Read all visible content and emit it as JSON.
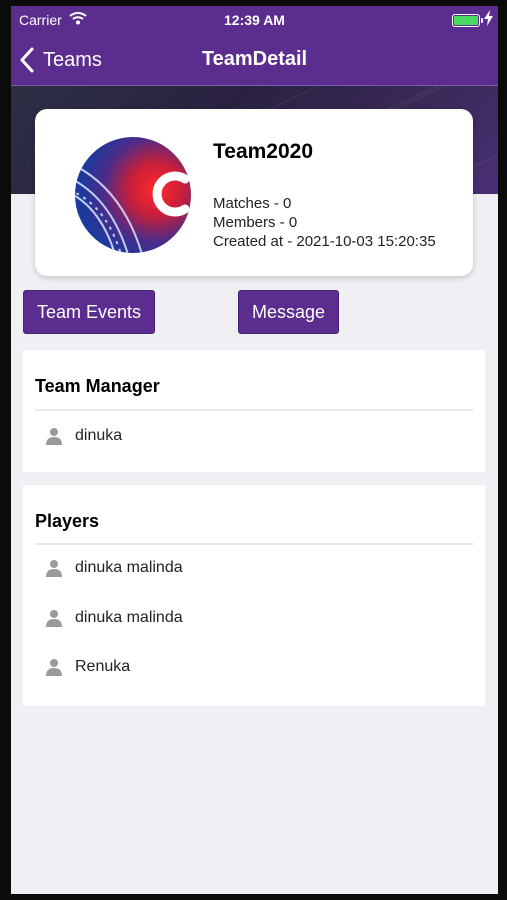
{
  "status": {
    "carrier": "Carrier",
    "time": "12:39 AM"
  },
  "nav": {
    "back_label": "Teams",
    "title": "TeamDetail"
  },
  "team": {
    "name": "Team2020",
    "matches": "Matches - 0",
    "members": "Members - 0",
    "created": "Created at - 2021-10-03 15:20:35"
  },
  "actions": {
    "events_label": "Team Events",
    "message_label": "Message"
  },
  "manager": {
    "title": "Team Manager",
    "name": "dinuka"
  },
  "players": {
    "title": "Players",
    "list": [
      "dinuka malinda",
      "dinuka malinda",
      "Renuka"
    ]
  },
  "colors": {
    "accent": "#5b2d8e",
    "battery": "#4cd964",
    "background": "#efeff4"
  },
  "icons": [
    "wifi-icon",
    "battery-icon",
    "back-chevron-icon",
    "person-icon"
  ]
}
